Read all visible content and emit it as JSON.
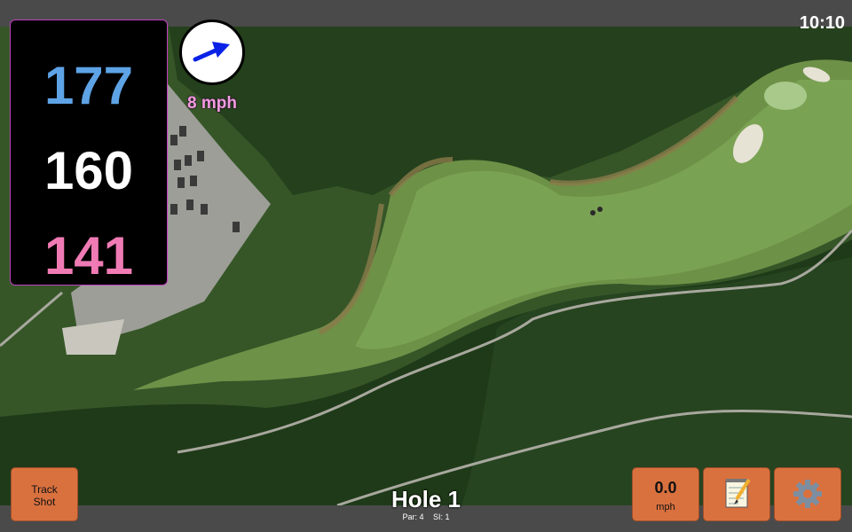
{
  "status_bar": {
    "time": "10:10"
  },
  "distances": {
    "back": "177",
    "middle": "160",
    "front": "141"
  },
  "wind": {
    "speed": "8 mph",
    "arrow_icon": "arrow-icon",
    "arrow_color": "#0a22e6"
  },
  "buttons": {
    "track_shot": "Track\nShot",
    "speed_value": "0.0",
    "speed_unit": "mph",
    "notes_icon": "notepad-icon",
    "settings_icon": "gear-icon"
  },
  "hole": {
    "title": "Hole 1",
    "par": "Par: 4",
    "si": "SI: 1"
  },
  "colors": {
    "button": "#d9713f",
    "back": "#5ea3e6",
    "front": "#f07bb4",
    "wind_text": "#f39ce0"
  }
}
